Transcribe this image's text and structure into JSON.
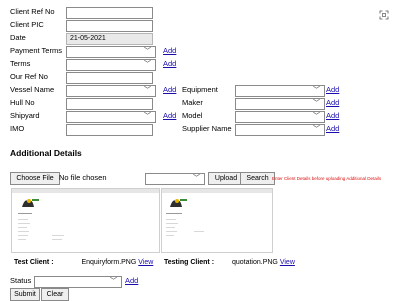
{
  "fields": {
    "client_ref_no": {
      "label": "Client Ref No",
      "value": ""
    },
    "client_pic": {
      "label": "Client PIC",
      "value": ""
    },
    "date": {
      "label": "Date",
      "value": "21-05-2021"
    },
    "payment_terms": {
      "label": "Payment Terms",
      "value": ""
    },
    "terms": {
      "label": "Terms",
      "value": ""
    },
    "our_ref_no": {
      "label": "Our Ref No",
      "value": ""
    },
    "vessel_name": {
      "label": "Vessel Name",
      "value": ""
    },
    "hull_no": {
      "label": "Hull No",
      "value": ""
    },
    "shipyard": {
      "label": "Shipyard",
      "value": ""
    },
    "imo": {
      "label": "IMO",
      "value": ""
    },
    "equipment": {
      "label": "Equipment",
      "value": ""
    },
    "maker": {
      "label": "Maker",
      "value": ""
    },
    "model": {
      "label": "Model",
      "value": ""
    },
    "supplier_name": {
      "label": "Supplier Name",
      "value": ""
    }
  },
  "add_label": "Add",
  "additional": {
    "heading": "Additional Details",
    "choose_file_label": "Choose File",
    "no_file_text": "No file chosen",
    "upload_label": "Upload",
    "search_label": "Search",
    "warning": "Enter Client Details before uploading Additional Details"
  },
  "attachments": [
    {
      "client_label": "Test Client :",
      "filename": "Enquiryform.PNG",
      "view_label": "View"
    },
    {
      "client_label": "Testing Client :",
      "filename": "quotation.PNG",
      "view_label": "View"
    }
  ],
  "status": {
    "label": "Status",
    "value": ""
  },
  "actions": {
    "submit": "Submit",
    "clear": "Clear"
  },
  "icons": {
    "fullscreen": "expand-icon",
    "dropdown": "chevron-down-icon",
    "thumb_logo": "logo-icon"
  }
}
